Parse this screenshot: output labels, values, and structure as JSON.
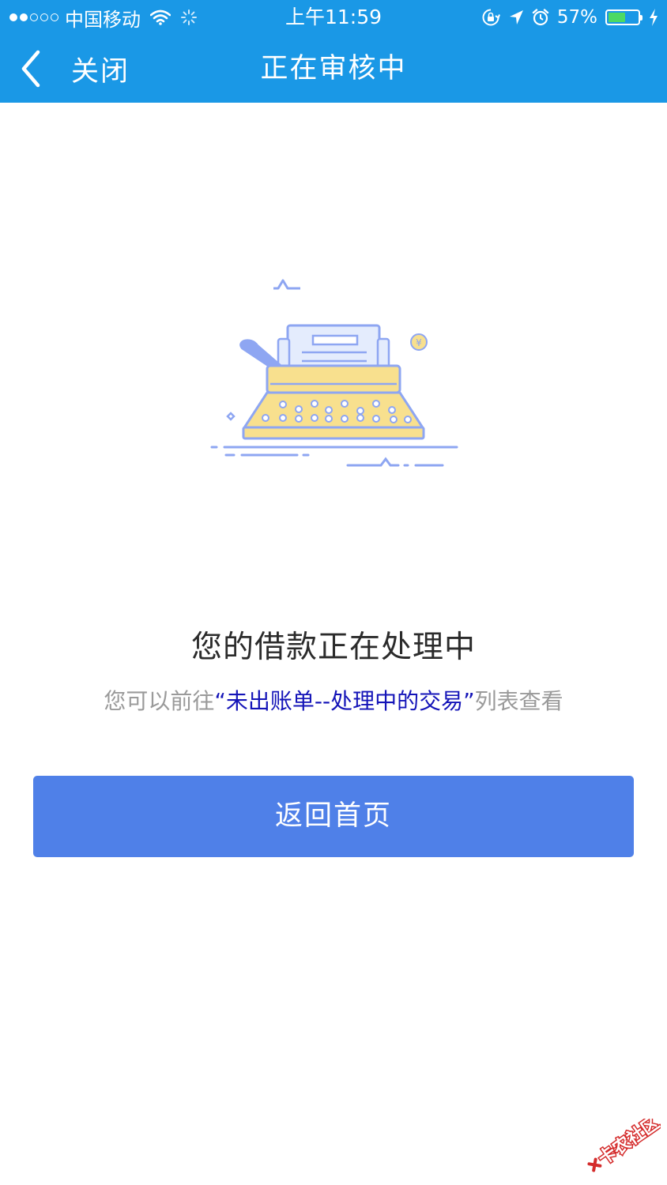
{
  "status_bar": {
    "signal": "●●○○○",
    "carrier": "中国移动",
    "time": "上午11:59",
    "battery_percent": "57%",
    "battery_level": 0.57,
    "icons": [
      "wifi-icon",
      "loading-icon",
      "rotation-lock-icon",
      "location-arrow-icon",
      "alarm-icon",
      "battery-icon",
      "charging-bolt-icon"
    ]
  },
  "nav": {
    "back_icon": "chevron-left-icon",
    "close_label": "关闭",
    "title": "正在审核中"
  },
  "illustration": {
    "icon": "typewriter-illustration",
    "coin_symbol": "¥"
  },
  "content": {
    "main_message": "您的借款正在处理中",
    "sub_prefix": "您可以前往",
    "sub_link": "“未出账单--处理中的交易”",
    "sub_suffix": "列表查看"
  },
  "button": {
    "label": "返回首页"
  },
  "watermark": {
    "text": "卡农社区"
  },
  "colors": {
    "nav_background": "#1a98e6",
    "button_background": "#4f80e8",
    "link_text": "#1414b8",
    "muted_text": "#9a9a9a",
    "illustration_yellow": "#f8e08e",
    "illustration_blue": "#8ea6f2"
  }
}
